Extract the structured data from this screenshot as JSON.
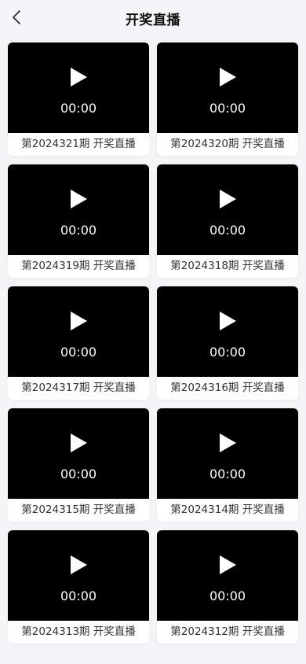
{
  "header": {
    "title": "开奖直播"
  },
  "videos": [
    {
      "time": "00:00",
      "caption": "第2024321期 开奖直播"
    },
    {
      "time": "00:00",
      "caption": "第2024320期 开奖直播"
    },
    {
      "time": "00:00",
      "caption": "第2024319期 开奖直播"
    },
    {
      "time": "00:00",
      "caption": "第2024318期 开奖直播"
    },
    {
      "time": "00:00",
      "caption": "第2024317期 开奖直播"
    },
    {
      "time": "00:00",
      "caption": "第2024316期 开奖直播"
    },
    {
      "time": "00:00",
      "caption": "第2024315期 开奖直播"
    },
    {
      "time": "00:00",
      "caption": "第2024314期 开奖直播"
    },
    {
      "time": "00:00",
      "caption": "第2024313期 开奖直播"
    },
    {
      "time": "00:00",
      "caption": "第2024312期 开奖直播"
    }
  ]
}
